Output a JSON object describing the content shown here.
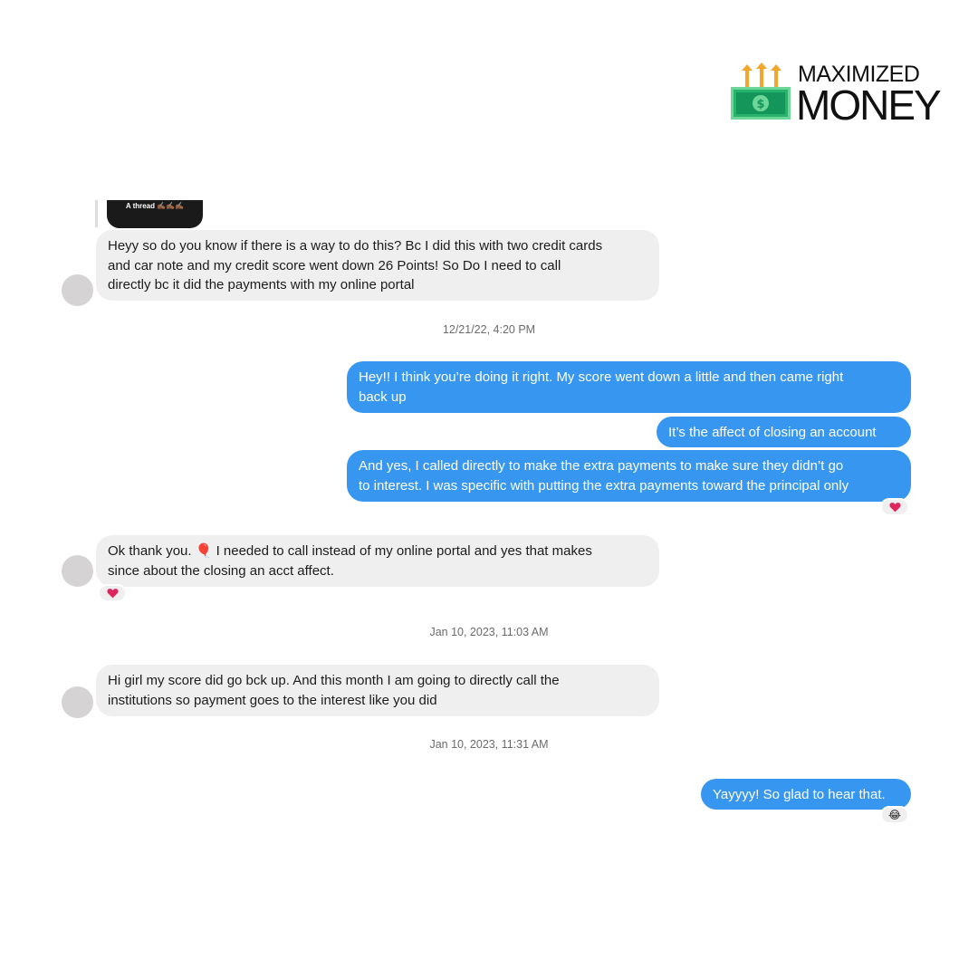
{
  "brand": {
    "line1": "MAXIMIZED",
    "line2": "MONEY",
    "colors": {
      "arrow": "#f3a62b",
      "bill": "#27b36b",
      "bill_dark": "#14955a",
      "bill_light": "#6fd69a"
    }
  },
  "story": {
    "label": "A thread ✍🏾✍🏾✍🏾"
  },
  "messages": [
    {
      "text": "Heyy so do you know if there is a way to do this? Bc I did this with two credit cards\nand car note and my credit score went down 26 Points! So Do I need to call\ndirectly bc it did the payments with my online portal"
    },
    {
      "text": "Hey!! I think you’re doing it right. My score went down a little and then came right\nback up"
    },
    {
      "text": "It’s the affect of closing an account"
    },
    {
      "text": "And yes, I called directly to make the extra payments to make sure they didn’t go\nto interest. I was specific with putting the extra payments toward the principal only"
    },
    {
      "text_before": "Ok thank you. ",
      "emoji": "🎈",
      "text_after": " I needed to call instead of my online portal and yes that makes\nsince about the closing an acct affect."
    },
    {
      "text": "Hi girl my score did go bck up. And this month I am going to directly call the\ninstitutions so payment goes to the interest like you did"
    },
    {
      "text": "Yayyyy! So glad to hear that."
    }
  ],
  "timestamps": [
    "12/21/22, 4:20 PM",
    "Jan 10, 2023, 11:03 AM",
    "Jan 10, 2023, 11:31 AM"
  ],
  "reactions": {
    "heart": "heart",
    "laugh": "😂"
  },
  "colors": {
    "outgoing": "#3797f0",
    "incoming": "#efefef",
    "heart": "#e0245e"
  }
}
